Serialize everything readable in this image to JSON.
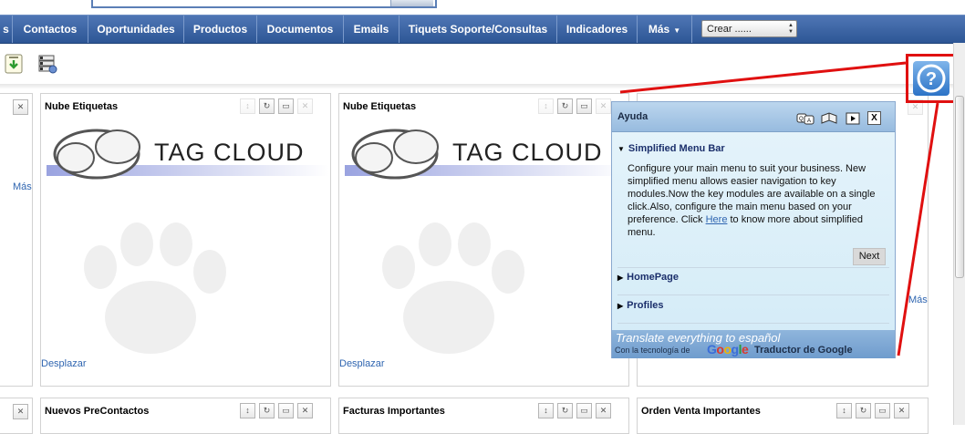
{
  "navbar": {
    "items": [
      {
        "label": "s"
      },
      {
        "label": "Contactos"
      },
      {
        "label": "Oportunidades"
      },
      {
        "label": "Productos"
      },
      {
        "label": "Documentos"
      },
      {
        "label": "Emails"
      },
      {
        "label": "Tiquets Soporte/Consultas"
      },
      {
        "label": "Indicadores"
      },
      {
        "label": "Más"
      }
    ],
    "crear_select": {
      "value": "Crear ......"
    }
  },
  "panels": {
    "row1": [
      {
        "title": "Nube Etiquetas",
        "footer_link": "Desplazar",
        "tagcloud_text": "TAG CLOUD"
      },
      {
        "title": "Nube Etiquetas",
        "footer_link": "Desplazar",
        "tagcloud_text": "TAG CLOUD"
      }
    ],
    "left_more_link": "Más",
    "right_more_link": "Más",
    "row2": [
      {
        "title": "Nuevos PreContactos"
      },
      {
        "title": "Facturas Importantes"
      },
      {
        "title": "Orden Venta Importantes"
      }
    ]
  },
  "help": {
    "title": "Ayuda",
    "close_label": "X",
    "sections": [
      {
        "heading": "Simplified Menu Bar",
        "expanded": true
      },
      {
        "heading": "HomePage",
        "expanded": false
      },
      {
        "heading": "Profiles",
        "expanded": false
      }
    ],
    "body_before_link": "Configure your main menu to suit your business. New simplified menu allows easier navigation to key modules.Now the key modules are available on a single click.Also, configure the main menu based on your preference. Click ",
    "body_link": "Here",
    "body_after_link": " to know more about simplified menu.",
    "next_label": "Next",
    "translate_line": "Translate everything to español",
    "powered_by": "Con la tecnología de",
    "google_word": "Google",
    "translator_name": "Traductor de Google"
  },
  "colors": {
    "navbar": "#3a63a6",
    "help_popup": "#d3ebf7",
    "annotation_red": "#e01010",
    "link": "#2f65b0"
  }
}
